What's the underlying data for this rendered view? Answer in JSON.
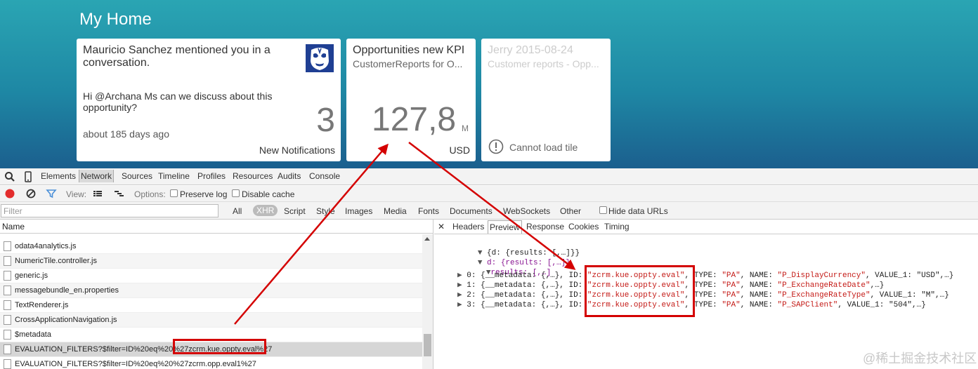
{
  "launchpad": {
    "title": "My Home",
    "tiles": [
      {
        "title": "Mauricio Sanchez mentioned you in a conversation.",
        "message": "Hi @Archana Ms can we discuss about this opportunity?",
        "time": "about 185 days ago",
        "number": "3",
        "footer": "New Notifications",
        "icon": "luchador-avatar-icon"
      },
      {
        "title": "Opportunities new KPI",
        "subtitle": "CustomerReports for O...",
        "number": "127,8",
        "unit": "M",
        "footer": "USD"
      },
      {
        "title": "Jerry 2015-08-24",
        "subtitle": "Customer reports - Opp...",
        "footer": "Cannot load tile",
        "icon": "warning-circle-icon"
      }
    ]
  },
  "devtools": {
    "tabs": [
      "Elements",
      "Network",
      "Sources",
      "Timeline",
      "Profiles",
      "Resources",
      "Audits",
      "Console"
    ],
    "active_tab": "Network",
    "toolbar": {
      "view_label": "View:",
      "options_label": "Options:",
      "preserve_log": "Preserve log",
      "disable_cache": "Disable cache"
    },
    "filter": {
      "placeholder": "Filter",
      "types": [
        "All",
        "XHR",
        "Script",
        "Style",
        "Images",
        "Media",
        "Fonts",
        "Documents",
        "WebSockets",
        "Other"
      ],
      "active_type": "XHR",
      "hide_data_urls": "Hide data URLs"
    },
    "requests": {
      "header": "Name",
      "items": [
        "odata4analytics.js",
        "NumericTile.controller.js",
        "generic.js",
        "messagebundle_en.properties",
        "TextRenderer.js",
        "CrossApplicationNavigation.js",
        "$metadata",
        "EVALUATION_FILTERS?$filter=ID%20eq%20%27zcrm.kue.oppty.eval%27",
        "EVALUATION_FILTERS?$filter=ID%20eq%20%27zcrm.opp.eval1%27"
      ],
      "selected_index": 7
    },
    "detail_tabs": [
      "Headers",
      "Preview",
      "Response",
      "Cookies",
      "Timing"
    ],
    "active_detail_tab": "Preview",
    "preview": {
      "root": "{d: {results: [,…]}}",
      "d_line": "d: {results: [,…]}",
      "results_label": "results: [,…]",
      "rows": [
        {
          "idx": "0",
          "metadata": "{,…}",
          "id": "\"zcrm.kue.oppty.eval\"",
          "type": "\"PA\"",
          "name": "\"P_DisplayCurrency\"",
          "extra": ", VALUE_1: \"USD\",…}"
        },
        {
          "idx": "1",
          "metadata": "{,…}",
          "id": "\"zcrm.kue.oppty.eval\"",
          "type": "\"PA\"",
          "name": "\"P_ExchangeRateDate\"",
          "extra": ",…}"
        },
        {
          "idx": "2",
          "metadata": "{,…}",
          "id": "\"zcrm.kue.oppty.eval\"",
          "type": "\"PA\"",
          "name": "\"P_ExchangeRateType\"",
          "extra": ", VALUE_1: \"M\",…}"
        },
        {
          "idx": "3",
          "metadata": "{,…}",
          "id": "\"zcrm.kue.oppty.eval\"",
          "type": "\"PA\"",
          "name": "\"P_SAPClient\"",
          "extra": ", VALUE_1: \"504\",…}"
        }
      ]
    }
  },
  "colors": {
    "annotation": "#d40000",
    "record_button": "#e32d2d",
    "filter_icon": "#4a8fd8"
  },
  "watermark": "@稀土掘金技术社区"
}
